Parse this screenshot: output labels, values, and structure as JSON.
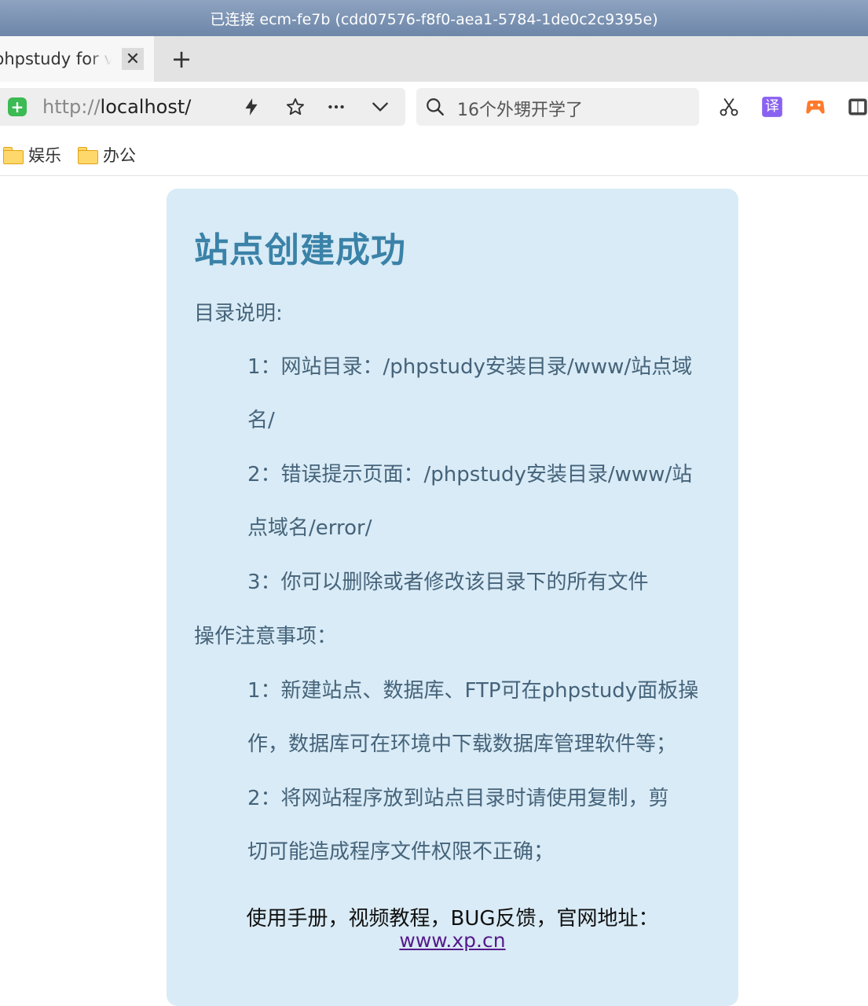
{
  "connection_bar": {
    "text": "已连接 ecm-fe7b (cdd07576-f8f0-aea1-5784-1de0c2c9395e)"
  },
  "tabs": [
    {
      "title": "phpstudy for v",
      "close_label": "✕"
    }
  ],
  "new_tab_label": "+",
  "address_bar": {
    "scheme": "http://",
    "host": "localhost/",
    "security_icon": "shield-icon"
  },
  "toolbar_icons": [
    "lightning-icon",
    "star-icon",
    "more-icon",
    "chevron-down-icon"
  ],
  "search": {
    "placeholder": "16个外甥开学了"
  },
  "extensions": [
    "scissors-icon",
    "translate-icon",
    "game-icon",
    "book-icon"
  ],
  "translate_glyph": "译",
  "bookmarks": [
    {
      "label": "娱乐"
    },
    {
      "label": "办公"
    }
  ],
  "page": {
    "title": "站点创建成功",
    "sections": [
      {
        "heading": "目录说明:",
        "lines": [
          "1：网站目录：/phpstudy安装目录/www/站点域",
          "名/",
          "2：错误提示页面：/phpstudy安装目录/www/站",
          "点域名/error/",
          "3：你可以删除或者修改该目录下的所有文件"
        ]
      },
      {
        "heading": "操作注意事项：",
        "lines": [
          "1：新建站点、数据库、FTP可在phpstudy面板操",
          "作，数据库可在环境中下载数据库管理软件等；",
          "2：将网站程序放到站点目录时请使用复制，剪",
          "切可能造成程序文件权限不正确；"
        ]
      }
    ],
    "footer_text": "使用手册，视频教程，BUG反馈，官网地址：",
    "footer_link": "www.xp.cn"
  },
  "colors": {
    "card_bg": "#d9ebf6",
    "title": "#3a82a8",
    "body_text": "#45637a",
    "link": "#551a8b"
  }
}
